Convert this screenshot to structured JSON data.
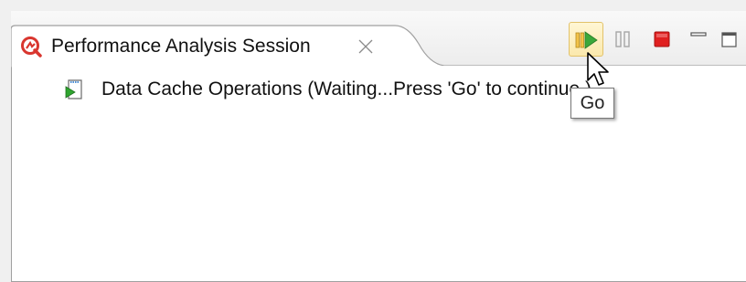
{
  "view": {
    "tab_title": "Performance Analysis Session",
    "tab_icon": "performance-analysis-icon",
    "close_icon": "close-x-icon"
  },
  "toolbar": {
    "go": {
      "icon": "go-icon",
      "tooltip": "Go"
    },
    "pause": {
      "icon": "pause-icon"
    },
    "stop": {
      "icon": "stop-icon"
    },
    "minimize": {
      "icon": "minimize-icon"
    },
    "maximize": {
      "icon": "maximize-icon"
    }
  },
  "tree": {
    "items": [
      {
        "icon": "operation-running-icon",
        "label": "Data Cache Operations (Waiting...Press 'Go' to continue.)"
      }
    ]
  },
  "colors": {
    "go_green": "#3aa83a",
    "stop_red": "#e02020",
    "tab_icon_red": "#d9362f",
    "hover_bg": "#fbe9ad"
  }
}
